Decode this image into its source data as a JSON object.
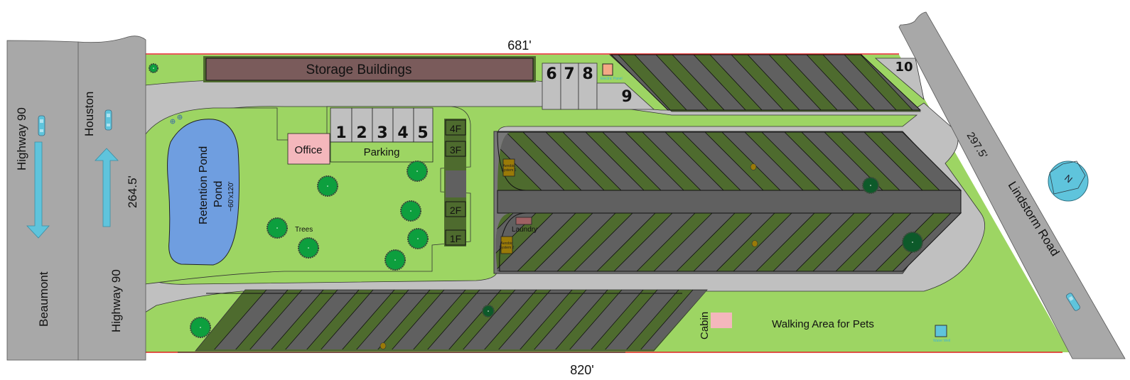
{
  "colors": {
    "grass": "#9dd563",
    "road": "#bdbdbd",
    "highway": "#a8a8a8",
    "pad_dark": "#606060",
    "pad_green": "#4e6b2e",
    "pond": "#6f9ee0",
    "storage": "#7a5b5b",
    "office": "#f4b7bc",
    "cabin": "#f4b7bc",
    "electric_panel": "#f3a985",
    "arrow": "#5fc4dc",
    "tree": "#0d9f3e",
    "tree_dark": "#0d5a2a",
    "aerobic": "#9a7a08",
    "boundary": "#e02020"
  },
  "dimensions": {
    "top": "681'",
    "bottom": "820'",
    "left": "264.5'",
    "right": "297.5'"
  },
  "roads": {
    "highway_west_label": "Highway 90",
    "highway_west_direction": "Beaumont",
    "highway_east_label": "Highway 90",
    "highway_east_direction": "Houston",
    "side_road": "Lindstorm Road"
  },
  "buildings": {
    "storage": "Storage Buildings",
    "office": "Office",
    "parking": "Parking",
    "laundry": "Laundry",
    "cabin": "Cabin",
    "electric_panel": "Electric Panel",
    "water_well": "Water Well",
    "aerobic_1": "Aerobic System 1",
    "aerobic_2": "Aerobic System 2"
  },
  "features": {
    "pond_name": "Retention Pond",
    "pond_size": "~60'x120'",
    "trees": "Trees",
    "pet_area": "Walking Area for Pets",
    "compass": "N"
  },
  "sites": {
    "row_a": [
      "1",
      "2",
      "3",
      "4",
      "5"
    ],
    "row_b": [
      "6",
      "7",
      "8"
    ],
    "site_9": "9",
    "site_10": "10",
    "floor_units": [
      "4F",
      "3F",
      "2F",
      "1F"
    ]
  }
}
